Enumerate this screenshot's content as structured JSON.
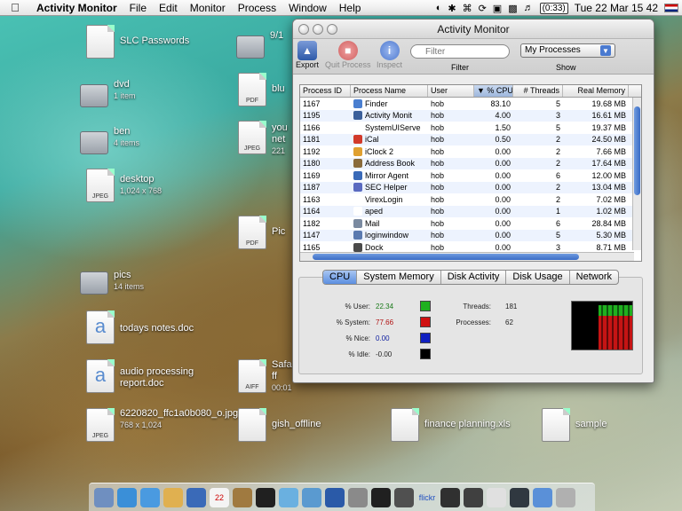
{
  "menubar": {
    "app": "Activity Monitor",
    "items": [
      "File",
      "Edit",
      "Monitor",
      "Process",
      "Window",
      "Help"
    ],
    "battery": "(0:33)",
    "clock": "Tue 22 Mar  15 42"
  },
  "desktop": {
    "icons": [
      {
        "name": "SLC Passwords",
        "sub": ""
      },
      {
        "name": "dvd",
        "sub": "1 item"
      },
      {
        "name": "ben",
        "sub": "4 items"
      },
      {
        "name": "desktop",
        "sub": "1,024 x 768"
      },
      {
        "name": "pics",
        "sub": "14 items"
      },
      {
        "name": "todays notes.doc",
        "sub": ""
      },
      {
        "name": "audio processing report.doc",
        "sub": ""
      },
      {
        "name": "6220820_ffc1a0b080_o.jpg",
        "sub": "768 x 1,024"
      },
      {
        "name": "gish_offline",
        "sub": ""
      },
      {
        "name": "finance planning.xls",
        "sub": ""
      },
      {
        "name": "sample",
        "sub": ""
      },
      {
        "name": "9/1",
        "sub": ""
      },
      {
        "name": "blu",
        "sub": ""
      },
      {
        "name": "you net",
        "sub": "221"
      },
      {
        "name": "Pic",
        "sub": ""
      },
      {
        "name": "Safa ff",
        "sub": "00:01"
      }
    ],
    "file_badges": {
      "pdf": "PDF",
      "jpeg": "JPEG",
      "aiff": "AIFF"
    }
  },
  "window": {
    "title": "Activity Monitor",
    "toolbar": {
      "export": "Export",
      "quit": "Quit Process",
      "inspect": "Inspect",
      "filter_placeholder": "Filter",
      "filter_label": "Filter",
      "show_value": "My Processes",
      "show_label": "Show"
    },
    "columns": [
      "Process ID",
      "Process Name",
      "User",
      "% CPU",
      "# Threads",
      "Real Memory"
    ],
    "rows": [
      {
        "pid": "1167",
        "name": "Finder",
        "user": "hob",
        "cpu": "83.10",
        "threads": "5",
        "mem": "19.68 MB",
        "color": "#4a7fd0"
      },
      {
        "pid": "1195",
        "name": "Activity Monit",
        "user": "hob",
        "cpu": "4.00",
        "threads": "3",
        "mem": "16.61 MB",
        "color": "#3b5f9a"
      },
      {
        "pid": "1166",
        "name": "SystemUIServe",
        "user": "hob",
        "cpu": "1.50",
        "threads": "5",
        "mem": "19.37 MB",
        "color": "#ffffff"
      },
      {
        "pid": "1181",
        "name": "iCal",
        "user": "hob",
        "cpu": "0.50",
        "threads": "2",
        "mem": "24.50 MB",
        "color": "#d23a2a"
      },
      {
        "pid": "1192",
        "name": "iClock 2",
        "user": "hob",
        "cpu": "0.00",
        "threads": "2",
        "mem": "7.66 MB",
        "color": "#e0a030"
      },
      {
        "pid": "1180",
        "name": "Address Book",
        "user": "hob",
        "cpu": "0.00",
        "threads": "2",
        "mem": "17.64 MB",
        "color": "#8a6b3a"
      },
      {
        "pid": "1169",
        "name": "Mirror Agent",
        "user": "hob",
        "cpu": "0.00",
        "threads": "6",
        "mem": "12.00 MB",
        "color": "#3a6ab8"
      },
      {
        "pid": "1187",
        "name": "SEC Helper",
        "user": "hob",
        "cpu": "0.00",
        "threads": "2",
        "mem": "13.04 MB",
        "color": "#5a6ac0"
      },
      {
        "pid": "1163",
        "name": "VirexLogin",
        "user": "hob",
        "cpu": "0.00",
        "threads": "2",
        "mem": "7.02 MB",
        "color": "#ffffff"
      },
      {
        "pid": "1164",
        "name": "aped",
        "user": "hob",
        "cpu": "0.00",
        "threads": "1",
        "mem": "1.02 MB",
        "color": "#ffffff"
      },
      {
        "pid": "1182",
        "name": "Mail",
        "user": "hob",
        "cpu": "0.00",
        "threads": "6",
        "mem": "28.84 MB",
        "color": "#7a8aa0"
      },
      {
        "pid": "1147",
        "name": "loginwindow",
        "user": "hob",
        "cpu": "0.00",
        "threads": "5",
        "mem": "5.30 MB",
        "color": "#5a7ab0"
      },
      {
        "pid": "1165",
        "name": "Dock",
        "user": "hob",
        "cpu": "0.00",
        "threads": "3",
        "mem": "8.71 MB",
        "color": "#4a4a4a"
      }
    ],
    "tabs": [
      "CPU",
      "System Memory",
      "Disk Activity",
      "Disk Usage",
      "Network"
    ],
    "cpu": {
      "user_label": "% User:",
      "user": "22.34",
      "user_color": "#1fb01f",
      "system_label": "% System:",
      "system": "77.66",
      "system_color": "#d01010",
      "nice_label": "% Nice:",
      "nice": "0.00",
      "nice_color": "#1020c0",
      "idle_label": "% Idle:",
      "idle": "-0.00",
      "idle_color": "#000000",
      "threads_label": "Threads:",
      "threads": "181",
      "processes_label": "Processes:",
      "processes": "62"
    }
  },
  "dock": {
    "icons": [
      "finder-icon",
      "safari-icon",
      "ichat-icon",
      "mail-icon",
      "preview-icon",
      "ical-icon",
      "address-book-icon",
      "dvd-icon",
      "itunes-icon",
      "iphoto-icon",
      "word-icon",
      "system-prefs-icon",
      "ink-icon",
      "iclock-icon",
      "flickr-icon",
      "tire-icon",
      "clapper-icon",
      "mouse-icon",
      "monitor-icon",
      "folder-icon",
      "trash-icon"
    ],
    "flickr_label": "flickr"
  }
}
